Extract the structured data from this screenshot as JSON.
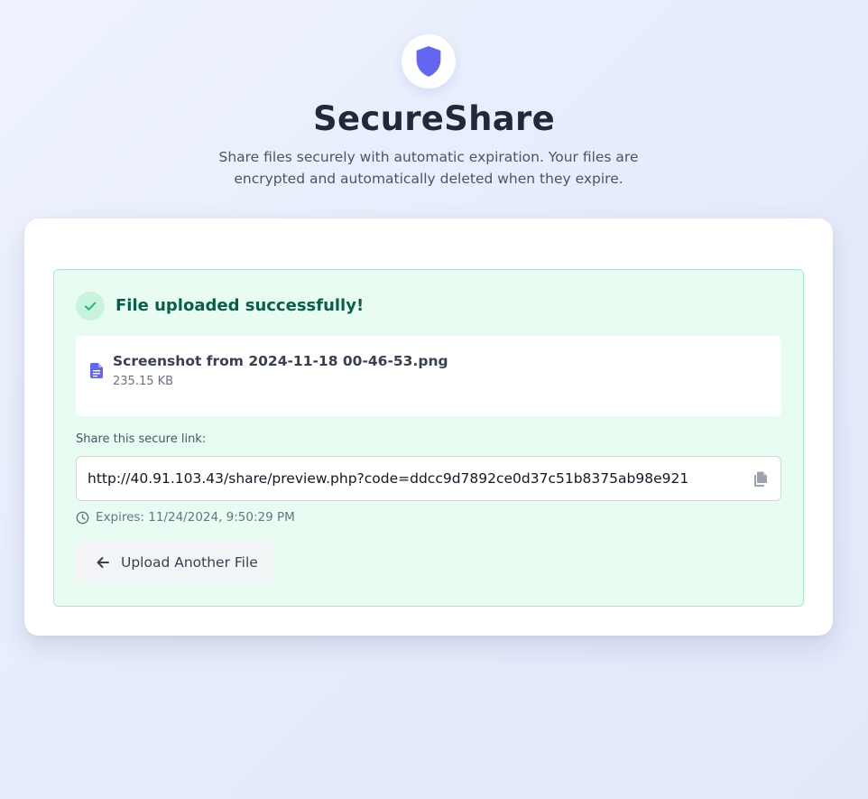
{
  "app": {
    "title": "SecureShare",
    "description": "Share files securely with automatic expiration. Your files are encrypted and automatically deleted when they expire.",
    "logo_icon": "shield-icon"
  },
  "result": {
    "status_icon": "check-icon",
    "title": "File uploaded successfully!",
    "file": {
      "icon": "document-icon",
      "name": "Screenshot from 2024-11-18 00-46-53.png",
      "size": "235.15 KB"
    },
    "link_label": "Share this secure link:",
    "link_value": "http://40.91.103.43/share/preview.php?code=ddcc9d7892ce0d37c51b8375ab98e921",
    "copy_icon": "copy-icon",
    "expires_icon": "clock-icon",
    "expires_text": "Expires: 11/24/2024, 9:50:29 PM",
    "back_button_label": "Upload Another File",
    "back_icon": "arrow-left-icon"
  },
  "colors": {
    "accent": "#6366f1",
    "success_bg": "#e8fcf2",
    "success_border": "#a7e9c8",
    "success_text": "#065f46",
    "success_check": "#10b981"
  }
}
